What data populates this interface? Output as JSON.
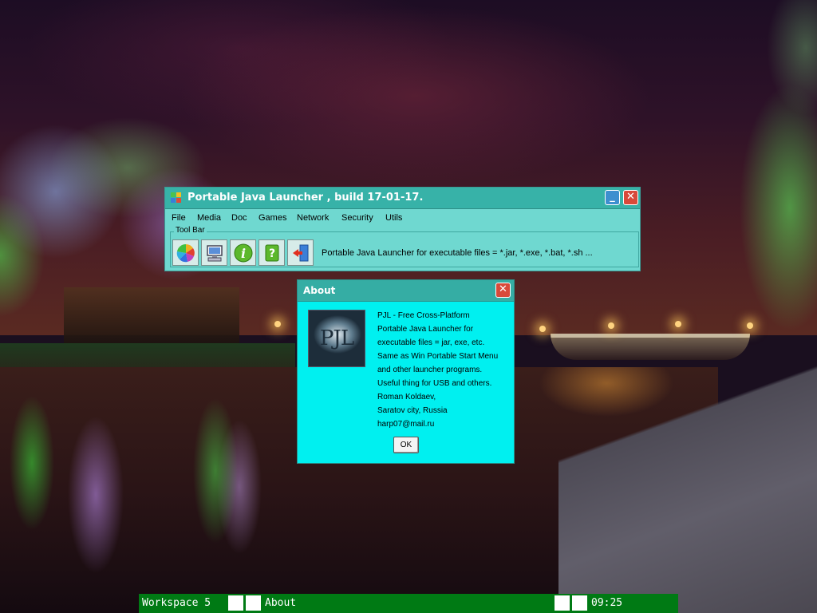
{
  "launcher": {
    "title": "Portable Java Launcher , build 17-01-17.",
    "min_glyph": "_",
    "close_glyph": "✕",
    "menu": [
      "File",
      "Media",
      "Doc",
      "Games",
      "Network",
      "Security",
      "Utils"
    ],
    "toolbar_label": "Tool Bar",
    "tool_buttons": [
      {
        "icon": "pinwheel-icon"
      },
      {
        "icon": "computer-icon"
      },
      {
        "icon": "info-icon"
      },
      {
        "icon": "help-icon"
      },
      {
        "icon": "exit-door-icon"
      }
    ],
    "toolbar_text": "Portable Java Launcher for executable files = *.jar, *.exe, *.bat, *.sh ..."
  },
  "about": {
    "title": "About",
    "close_glyph": "✕",
    "logo_text": "PJL",
    "lines": [
      "PJL - Free Cross-Platform",
      "Portable Java Launcher for",
      "executable files = jar, exe, etc.",
      "Same as Win Portable Start Menu",
      "and other launcher programs.",
      "Useful thing for USB and others.",
      "Roman Koldaev,",
      "Saratov city, Russia",
      "harp07@mail.ru"
    ],
    "ok_label": "OK"
  },
  "taskbar": {
    "workspace": "Workspace 5",
    "active_window": "About",
    "clock": "09:25",
    "color": "#007a14"
  },
  "colors": {
    "window_bg": "#6fd8d0",
    "titlebar": "#37b2a8",
    "dialog_bg": "#00f0f0",
    "close_red": "#d84a3a"
  }
}
